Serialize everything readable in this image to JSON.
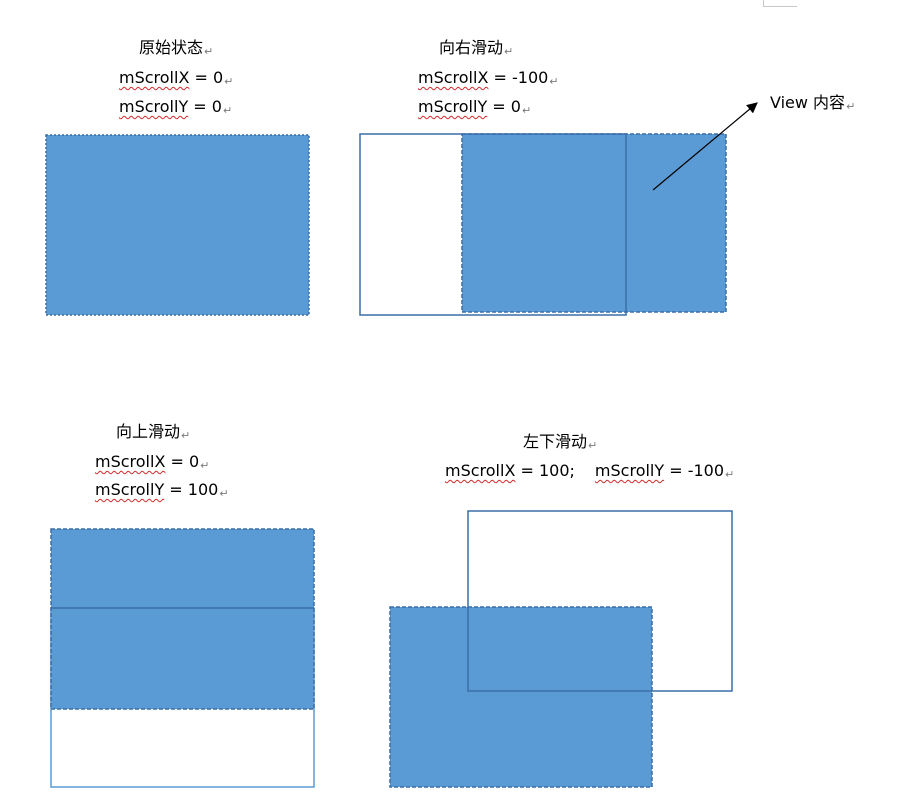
{
  "colors": {
    "fill": "#5b9bd5",
    "frame": "#3a6ea8",
    "frame_light": "#5b9bd5",
    "squiggle": "#d12a2a"
  },
  "pilcrow": "↵",
  "panels": [
    {
      "title": "原始状态",
      "x_var": "mScrollX",
      "x_rest": " = 0",
      "y_var": "mScrollY",
      "y_rest": " = 0"
    },
    {
      "title": "向右滑动",
      "x_var": "mScrollX",
      "x_rest": " = -100",
      "y_var": "mScrollY",
      "y_rest": " = 0"
    },
    {
      "title": "向上滑动",
      "x_var": "mScrollX",
      "x_rest": " = 0",
      "y_var": "mScrollY",
      "y_rest": " = 100"
    },
    {
      "title": "左下滑动",
      "x_var": "mScrollX",
      "x_rest": " = 100;",
      "y_var": "mScrollY",
      "y_rest": " = -100"
    }
  ],
  "callout": {
    "label": "View 内容"
  }
}
